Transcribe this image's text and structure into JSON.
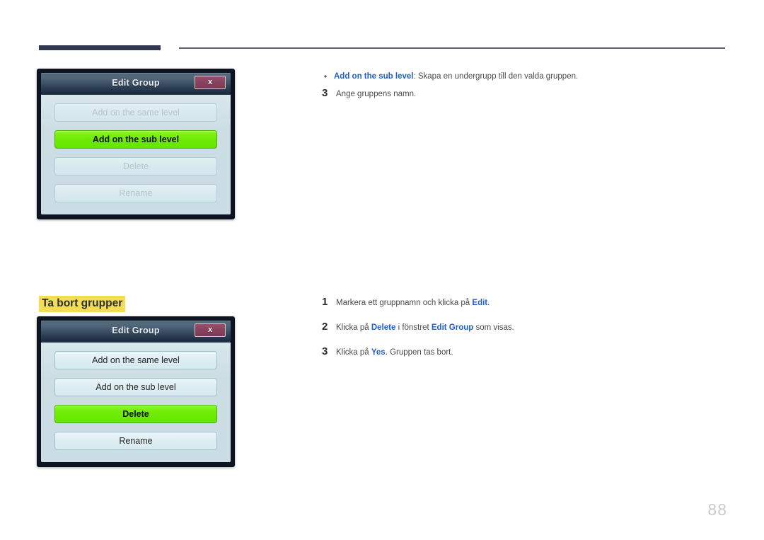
{
  "page": {
    "number": "88",
    "heading": "Ta bort grupper"
  },
  "dialog_top": {
    "title": "Edit Group",
    "close_label": "x",
    "buttons": [
      {
        "label": "Add on the same level",
        "state": "disabled"
      },
      {
        "label": "Add on the sub level",
        "state": "selected"
      },
      {
        "label": "Delete",
        "state": "disabled"
      },
      {
        "label": "Rename",
        "state": "disabled"
      }
    ]
  },
  "dialog_bottom": {
    "title": "Edit Group",
    "close_label": "x",
    "buttons": [
      {
        "label": "Add on the same level",
        "state": "normal"
      },
      {
        "label": "Add on the sub level",
        "state": "normal"
      },
      {
        "label": "Delete",
        "state": "selected"
      },
      {
        "label": "Rename",
        "state": "normal"
      }
    ]
  },
  "top_text": {
    "bullet": {
      "marker": "•",
      "keyword": "Add on the sub level",
      "rest": ": Skapa en undergrupp till den valda gruppen."
    },
    "step3": {
      "number": "3",
      "text": "Ange gruppens namn."
    }
  },
  "bottom_steps": [
    {
      "number": "1",
      "part1": "Markera ett gruppnamn och klicka på ",
      "kw1": "Edit",
      "part2": ".",
      "kw2": "",
      "part3": ""
    },
    {
      "number": "2",
      "part1": "Klicka på ",
      "kw1": "Delete",
      "part2": " i fönstret ",
      "kw2": "Edit Group",
      "part3": " som visas."
    },
    {
      "number": "3",
      "part1": "Klicka på ",
      "kw1": "Yes",
      "part2": ". Gruppen tas bort.",
      "kw2": "",
      "part3": ""
    }
  ],
  "colors": {
    "accent_blue": "#1f5fd0",
    "highlight_yellow": "#f2dd55",
    "selected_green": "#72ee07",
    "rule_dark": "#323852"
  }
}
